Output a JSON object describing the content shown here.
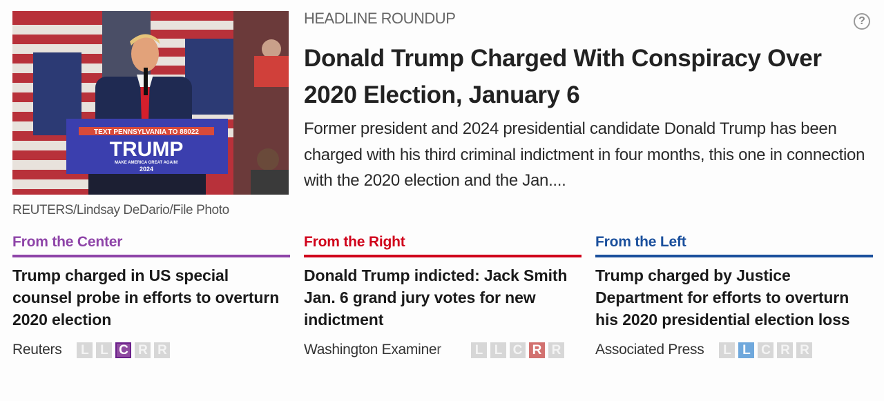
{
  "photo": {
    "alt": "Donald Trump speaking at a podium at a rally",
    "podium_line1": "TEXT PENNSYLVANIA TO 88022",
    "podium_name": "TRUMP",
    "podium_line2": "MAKE AMERICA GREAT AGAIN!",
    "podium_year": "2024",
    "credit": "REUTERS/Lindsay DeDario/File Photo"
  },
  "header": {
    "kicker": "HEADLINE ROUNDUP",
    "help_icon": "?",
    "title": "Donald Trump Charged With Conspiracy Over 2020 Election, January 6",
    "summary": "Former president and 2024 presidential candidate Donald Trump has been charged with his third criminal indictment in four months, this one in connection with the 2020 election and the Jan...."
  },
  "columns": [
    {
      "label": "From the Center",
      "color": "#8e44a8",
      "headline": "Trump charged in US special counsel probe in efforts to overturn 2020 election",
      "source": "Reuters",
      "bias_letters": [
        "L",
        "L",
        "C",
        "R",
        "R"
      ],
      "bias_active_index": 2,
      "bias_active_color": "#8e4aa0"
    },
    {
      "label": "From the Right",
      "color": "#d0021b",
      "headline": "Donald Trump indicted: Jack Smith Jan. 6 grand jury votes for new indictment",
      "source": "Washington Examiner",
      "bias_letters": [
        "L",
        "L",
        "C",
        "R",
        "R"
      ],
      "bias_active_index": 3,
      "bias_active_color": "#d2716f"
    },
    {
      "label": "From the Left",
      "color": "#1a4f9c",
      "headline": "Trump charged by Justice Department for efforts to overturn his 2020 presidential election loss",
      "source": "Associated Press",
      "bias_letters": [
        "L",
        "L",
        "C",
        "R",
        "R"
      ],
      "bias_active_index": 1,
      "bias_active_color": "#6fa8dc"
    }
  ]
}
